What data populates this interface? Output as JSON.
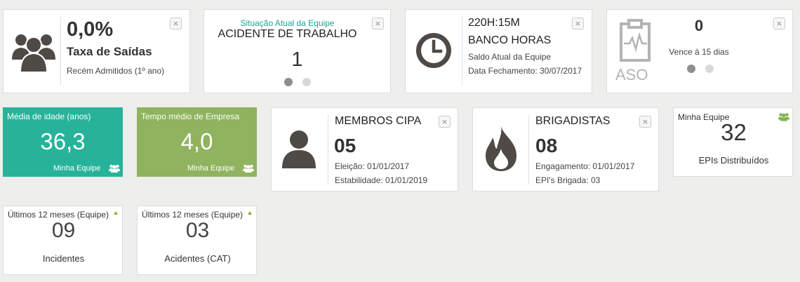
{
  "colors": {
    "teal": "#27b39a",
    "green": "#8fb35e",
    "icon": "#4f4a45",
    "accent": "#1aa598",
    "arrow": "#7fb347"
  },
  "saidas": {
    "value": "0,0%",
    "title": "Taxa de Saídas",
    "subtitle": "Recém Admitidos (1º ano)",
    "close": "×",
    "icon": "team-icon"
  },
  "situacao": {
    "label": "Situação Atual da Equipe",
    "title": "ACIDENTE DE TRABALHO",
    "value": "1",
    "close": "×"
  },
  "banco": {
    "value": "220H:15M",
    "title": "BANCO HORAS",
    "line1": "Saldo Atual da Equipe",
    "line2": "Data Fechamento: 30/07/2017",
    "close": "×",
    "icon": "clock-icon"
  },
  "aso": {
    "value": "0",
    "subtitle": "Vence à 15 dias",
    "logo": "ASO",
    "close": "×"
  },
  "idade": {
    "label": "Média de idade (anos)",
    "value": "36,3",
    "footer": "Minha Equipe"
  },
  "tempo": {
    "label": "Tempo médio de Empresa",
    "value": "4,0",
    "footer": "Minha Equipe"
  },
  "cipa": {
    "title": "MEMBROS CIPA",
    "value": "05",
    "line1": "Eleição: 01/01/2017",
    "line2": "Estabilidade: 01/01/2019",
    "close": "×",
    "icon": "person-icon"
  },
  "brigada": {
    "title": "BRIGADISTAS",
    "value": "08",
    "line1": "Engagamento: 01/01/2017",
    "line2": "EPI's Brigada: 03",
    "close": "×",
    "icon": "fire-icon"
  },
  "epis": {
    "label": "Minha Equipe",
    "value": "32",
    "footer": "EPIs Distribuídos"
  },
  "incidentes": {
    "label": "Últimos 12 meses (Equipe)",
    "value": "09",
    "footer": "Incidentes"
  },
  "acidentes": {
    "label": "Últimos 12 meses (Equipe)",
    "value": "03",
    "footer": "Acidentes (CAT)"
  }
}
